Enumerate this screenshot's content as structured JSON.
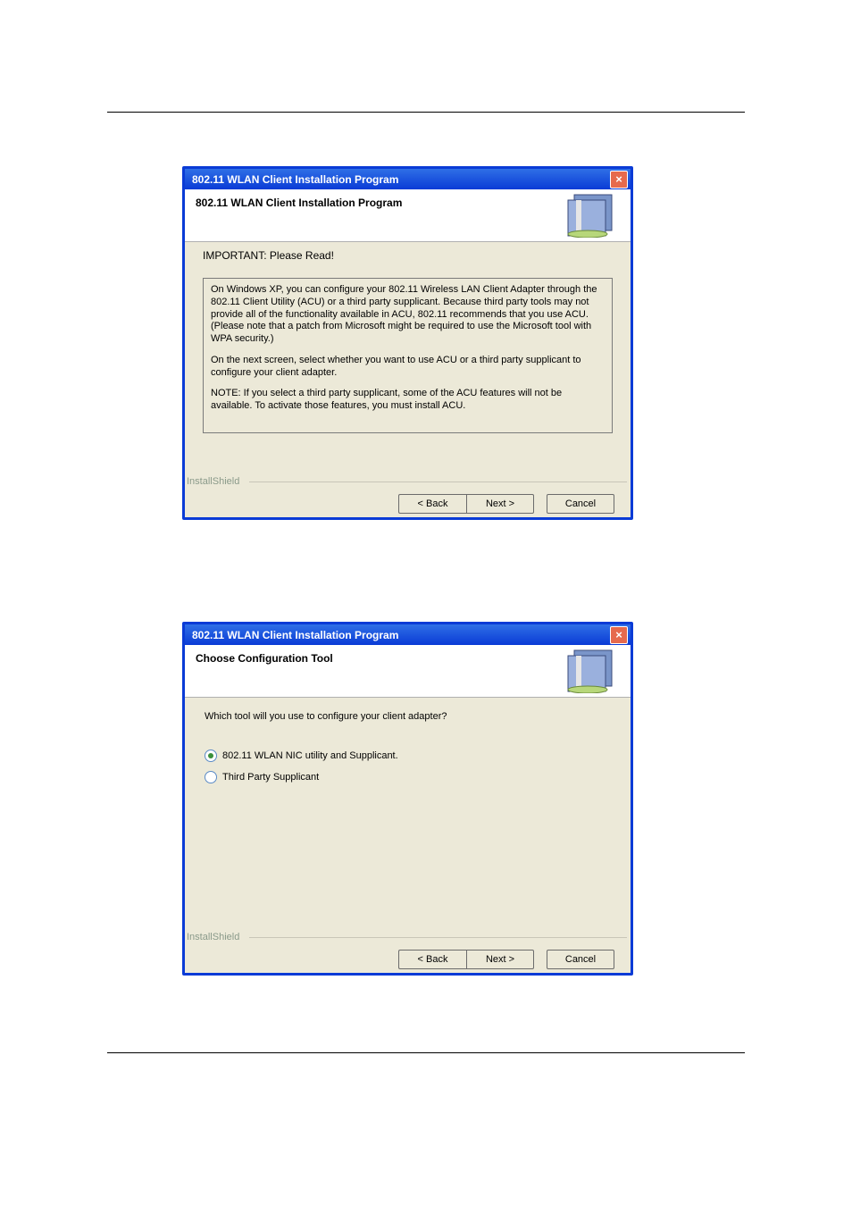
{
  "dialog1": {
    "title": "802.11 WLAN Client Installation Program",
    "banner_title": "802.11 WLAN Client Installation Program",
    "important": "IMPORTANT: Please Read!",
    "para1": "On Windows XP, you can configure your 802.11 Wireless LAN Client Adapter through the 802.11 Client Utility (ACU) or a third party supplicant. Because third party tools may not provide all of the functionality available in ACU, 802.11 recommends that you use ACU. (Please note that a patch from Microsoft might be required to use the Microsoft tool with WPA security.)",
    "para2": "On the next screen, select whether you want to use ACU or a third party supplicant to configure your client adapter.",
    "para3": "NOTE: If you select a third party supplicant, some of the ACU features will not be available. To activate those features, you must install ACU.",
    "installshield": "InstallShield",
    "back": "< Back",
    "next": "Next >",
    "cancel": "Cancel"
  },
  "dialog2": {
    "title": "802.11 WLAN Client Installation Program",
    "banner_title": "Choose Configuration Tool",
    "question": "Which tool will you use to configure your client adapter?",
    "option1": "802.11 WLAN NIC utility and Supplicant.",
    "option2": "Third Party Supplicant",
    "installshield": "InstallShield",
    "back": "< Back",
    "next": "Next >",
    "cancel": "Cancel"
  }
}
